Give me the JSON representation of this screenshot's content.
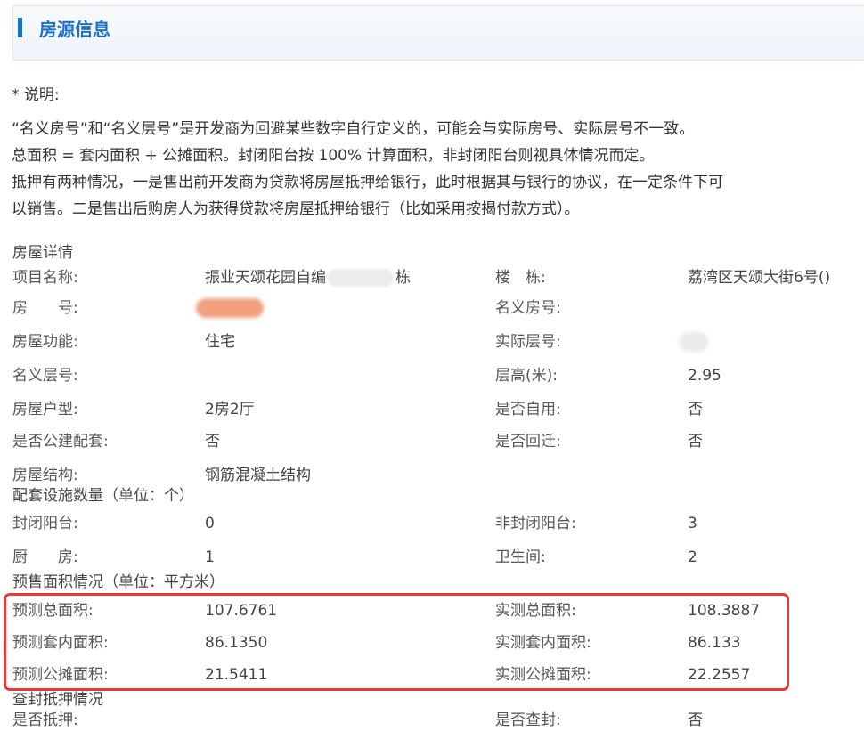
{
  "header": {
    "title": "房源信息"
  },
  "notes": {
    "lines": [
      "* 说明:",
      "“名义房号”和“名义层号”是开发商为回避某些数字自行定义的，可能会与实际房号、实际层号不一致。",
      "总面积 = 套内面积 + 公摊面积。封闭阳台按 100% 计算面积，非封闭阳台则视具体情况而定。",
      "抵押有两种情况，一是售出前开发商为贷款将房屋抵押给银行，此时根据其与银行的协议，在一定条件下可",
      "以销售。二是售出后购房人为获得贷款将房屋抵押给银行（比如采用按揭付款方式）。"
    ]
  },
  "details": {
    "title": "房屋详情",
    "rows": [
      {
        "l1": "项目名称:",
        "v1a": "振业天颂花园自编",
        "v1b": "栋",
        "l2": "楼　栋:",
        "v2": "荔湾区天颂大街6号()"
      },
      {
        "l1": "房　　号:",
        "v1": "",
        "l2": "名义房号:",
        "v2": ""
      },
      {
        "l1": "房屋功能:",
        "v1": "住宅",
        "l2": "实际层号:",
        "v2": ""
      },
      {
        "l1": "名义层号:",
        "v1": "",
        "l2": "层高(米):",
        "v2": "2.95"
      },
      {
        "l1": "房屋户型:",
        "v1": "2房2厅",
        "l2": "是否自用:",
        "v2": "否"
      },
      {
        "l1": "是否公建配套:",
        "v1": "否",
        "l2": "是否回迁:",
        "v2": "否"
      },
      {
        "l1": "房屋结构:",
        "v1": "钢筋混凝土结构",
        "l2": "",
        "v2": ""
      }
    ]
  },
  "facilities": {
    "title": "配套设施数量（单位：个）",
    "rows": [
      {
        "l1": "封闭阳台:",
        "v1": "0",
        "l2": "非封闭阳台:",
        "v2": "3"
      },
      {
        "l1": "厨　　房:",
        "v1": "1",
        "l2": "卫生间:",
        "v2": "2"
      }
    ]
  },
  "area": {
    "title": "预售面积情况（单位：平方米）",
    "rows": [
      {
        "l1": "预测总面积:",
        "v1": "107.6761",
        "l2": "实测总面积:",
        "v2": "108.3887"
      },
      {
        "l1": "预测套内面积:",
        "v1": "86.1350",
        "l2": "实测套内面积:",
        "v2": "86.133"
      },
      {
        "l1": "预测公摊面积:",
        "v1": "21.5411",
        "l2": "实测公摊面积:",
        "v2": "22.2557"
      }
    ]
  },
  "seizure": {
    "title": "查封抵押情况",
    "rows": [
      {
        "l1": "是否抵押:",
        "v1": "",
        "l2": "是否查封:",
        "v2": "否"
      }
    ]
  },
  "colors": {
    "accent": "#1f6fc5",
    "highlight": "#e53935"
  }
}
